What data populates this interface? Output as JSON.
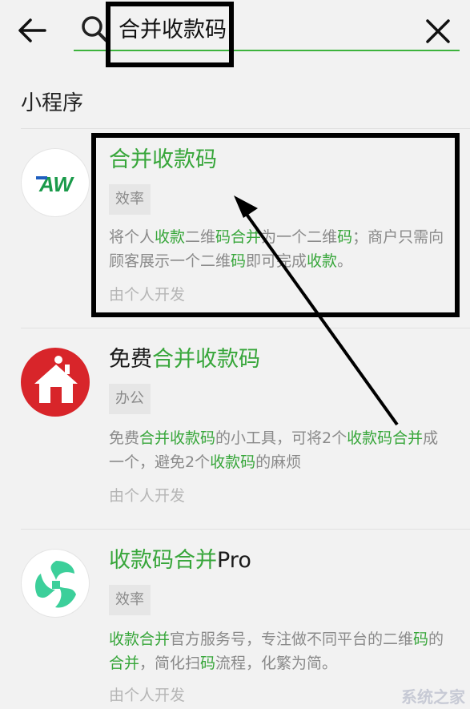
{
  "search": {
    "query": "合并收款码"
  },
  "section": {
    "title": "小程序"
  },
  "results": [
    {
      "title_parts": [
        {
          "t": "合并收款码",
          "g": true
        }
      ],
      "tag": "效率",
      "desc_parts": [
        {
          "t": "将个人",
          "g": false
        },
        {
          "t": "收款",
          "g": true
        },
        {
          "t": "二维",
          "g": false
        },
        {
          "t": "码合并",
          "g": true
        },
        {
          "t": "为一个二维",
          "g": false
        },
        {
          "t": "码",
          "g": true
        },
        {
          "t": "；商户只需向顾客展示一个二维",
          "g": false
        },
        {
          "t": "码",
          "g": true
        },
        {
          "t": "即可完成",
          "g": false
        },
        {
          "t": "收款",
          "g": true
        },
        {
          "t": "。",
          "g": false
        }
      ],
      "developer": "由个人开发",
      "logo_text": "AW"
    },
    {
      "title_parts": [
        {
          "t": "免费",
          "g": false
        },
        {
          "t": "合并收款码",
          "g": true
        }
      ],
      "tag": "办公",
      "desc_parts": [
        {
          "t": "免费",
          "g": false
        },
        {
          "t": "合并收款码",
          "g": true
        },
        {
          "t": "的小工具，可将2个",
          "g": false
        },
        {
          "t": "收款码合并",
          "g": true
        },
        {
          "t": "成一个，避免2个",
          "g": false
        },
        {
          "t": "收款码",
          "g": true
        },
        {
          "t": "的麻烦",
          "g": false
        }
      ],
      "developer": "由个人开发",
      "logo_text": ""
    },
    {
      "title_parts": [
        {
          "t": "收款码合并",
          "g": true
        },
        {
          "t": "Pro",
          "g": false
        }
      ],
      "tag": "效率",
      "desc_parts": [
        {
          "t": "收款合并",
          "g": true
        },
        {
          "t": "官方服务号，专注做不同平台的二维",
          "g": false
        },
        {
          "t": "码",
          "g": true
        },
        {
          "t": "的",
          "g": false
        },
        {
          "t": "合并",
          "g": true
        },
        {
          "t": "，简化扫",
          "g": false
        },
        {
          "t": "码",
          "g": true
        },
        {
          "t": "流程，化繁为简。",
          "g": false
        }
      ],
      "developer": "由个人开发",
      "logo_text": ""
    }
  ],
  "watermark": "系统之家",
  "colors": {
    "highlight": "#37a63a",
    "background": "#f2f2f2",
    "secondary_text": "#8a8a8a"
  },
  "icons": [
    "back-arrow-icon",
    "search-icon",
    "clear-icon"
  ]
}
